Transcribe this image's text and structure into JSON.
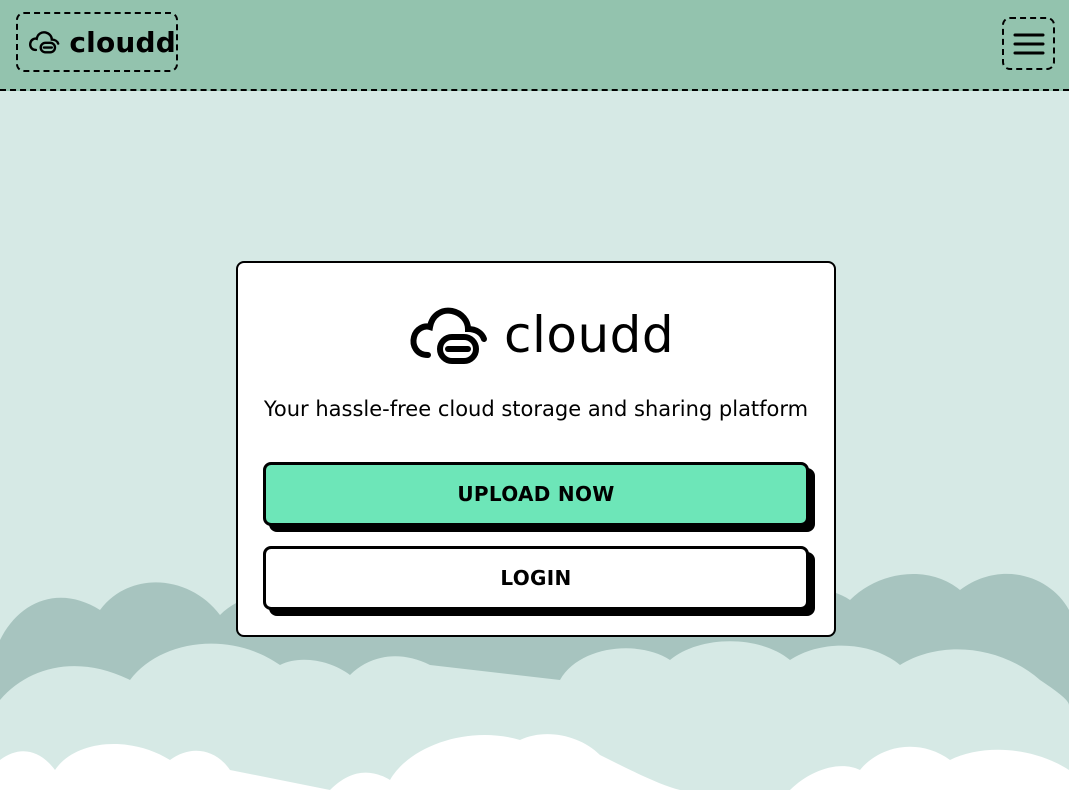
{
  "header": {
    "brand_name": "cloudd",
    "brand_icon": "cloud-link-icon",
    "menu_icon": "hamburger-menu-icon",
    "background": "#93c3ae"
  },
  "hero": {
    "logo_name": "cloudd",
    "tagline": "Your hassle-free cloud storage and sharing platform",
    "upload_label": "UPLOAD NOW",
    "login_label": "LOGIN",
    "upload_color": "#6de6b8"
  },
  "page": {
    "background": "#d6e9e5",
    "cloud_back_color": "#a7c4bf",
    "cloud_front_color": "#ffffff"
  }
}
